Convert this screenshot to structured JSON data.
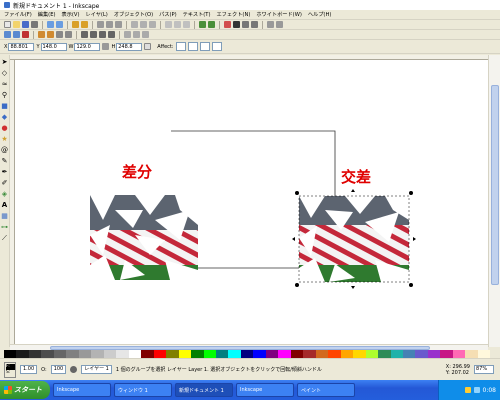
{
  "window": {
    "title": "新規ドキュメント 1 - Inkscape"
  },
  "menubar": [
    "ファイル(F)",
    "編集(E)",
    "表示(V)",
    "レイヤ(L)",
    "オブジェクト(O)",
    "パス(P)",
    "テキスト(T)",
    "エフェクト(N)",
    "ホワイトボード(W)",
    "ヘルプ(H)"
  ],
  "toolbar": {
    "x_label": "X",
    "x_value": "88.801",
    "y_label": "Y",
    "y_value": "148.0",
    "w_label": "W",
    "w_value": "129.0",
    "h_label": "H",
    "h_value": "248.8",
    "affect_label": "Affect:"
  },
  "canvas": {
    "caption_left": "差分",
    "caption_right": "交差"
  },
  "statusbar": {
    "fill_label": "F:",
    "stroke_label": "S:",
    "stroke_value": "1.00",
    "opacity_label": "O:",
    "opacity_value": "100",
    "layer_label": "レイヤー 1",
    "message": "1 個のグループを選択 レイヤー Layer 1. 選択オブジェクトをクリックで回転/傾斜ハンドル",
    "x_coord": "X: 296.99",
    "y_coord": "Y: 207.02",
    "zoom": "87%"
  },
  "taskbar": {
    "start_label": "スタート",
    "tasks": [
      "Inkscape",
      "ウィンドウ 1",
      "新規ドキュメント 1",
      "Inkscape",
      "ペイント"
    ],
    "active_task": 2,
    "clock": "0:08"
  }
}
